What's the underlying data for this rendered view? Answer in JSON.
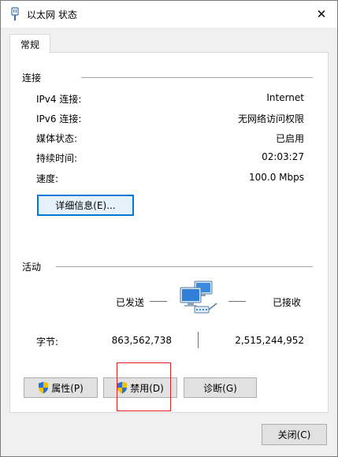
{
  "window": {
    "title": "以太网 状态",
    "close_glyph": "✕"
  },
  "tabs": [
    {
      "label": "常规"
    }
  ],
  "connection": {
    "title": "连接",
    "rows": [
      {
        "label": "IPv4 连接:",
        "value": "Internet"
      },
      {
        "label": "IPv6 连接:",
        "value": "无网络访问权限"
      },
      {
        "label": "媒体状态:",
        "value": "已启用"
      },
      {
        "label": "持续时间:",
        "value": "02:03:27"
      },
      {
        "label": "速度:",
        "value": "100.0 Mbps"
      }
    ],
    "details_button": "详细信息(E)..."
  },
  "activity": {
    "title": "活动",
    "sent_label": "已发送",
    "received_label": "已接收",
    "bytes_label": "字节:",
    "bytes_sent": "863,562,738",
    "bytes_received": "2,515,244,952",
    "network_icon": "network-computers-icon"
  },
  "buttons": {
    "properties": "属性(P)",
    "disable": "禁用(D)",
    "diagnose": "诊断(G)",
    "close": "关闭(C)"
  },
  "colors": {
    "accent": "#0078d7",
    "shield_blue": "#2a6fd6",
    "shield_yellow": "#f2c200",
    "highlight_red": "#e02020"
  }
}
